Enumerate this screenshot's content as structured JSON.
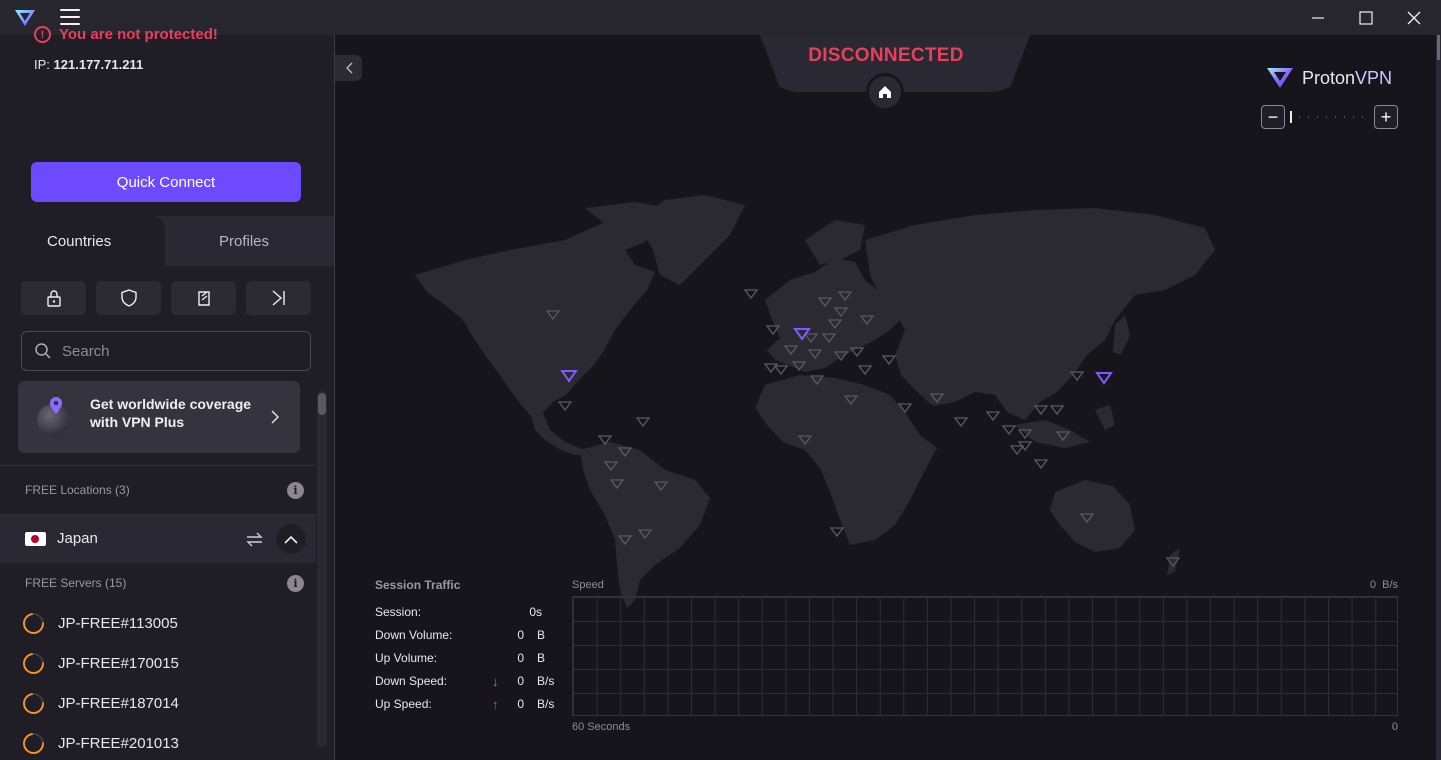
{
  "titlebar": {
    "minimize_icon": "minimize-icon",
    "maximize_icon": "maximize-icon",
    "close_icon": "close-icon"
  },
  "status": {
    "warning": "You are not protected!",
    "ip_label": "IP:",
    "ip_value": "121.177.71.211",
    "connection": "DISCONNECTED",
    "connection_color": "#ea3f5a"
  },
  "quick_connect": "Quick Connect",
  "tabs": {
    "countries": "Countries",
    "profiles": "Profiles"
  },
  "filters": [
    "lock-icon",
    "shield-icon",
    "tor-icon",
    "p2p-icon"
  ],
  "search": {
    "placeholder": "Search"
  },
  "upsell": {
    "text": "Get worldwide coverage with VPN Plus"
  },
  "free_locations": {
    "label": "FREE Locations (3)"
  },
  "country": {
    "name": "Japan"
  },
  "free_servers": {
    "label": "FREE Servers (15)"
  },
  "servers": [
    "JP-FREE#113005",
    "JP-FREE#170015",
    "JP-FREE#187014",
    "JP-FREE#201013"
  ],
  "brand": {
    "name_a": "Proton",
    "name_b": "VPN",
    "accent": "#6d4aff"
  },
  "traffic": {
    "title": "Session Traffic",
    "rows": [
      {
        "label": "Session:",
        "value": "0s",
        "unit": ""
      },
      {
        "label": "Down Volume:",
        "value": "0",
        "unit": "B"
      },
      {
        "label": "Up Volume:",
        "value": "0",
        "unit": "B"
      },
      {
        "label": "Down Speed:",
        "value": "0",
        "unit": "B/s",
        "arrow": "↓"
      },
      {
        "label": "Up Speed:",
        "value": "0",
        "unit": "B/s",
        "arrow": "↑"
      }
    ],
    "speed_label": "Speed",
    "speed_value": "0  B/s",
    "x_start": "60 Seconds",
    "x_end": "0"
  }
}
